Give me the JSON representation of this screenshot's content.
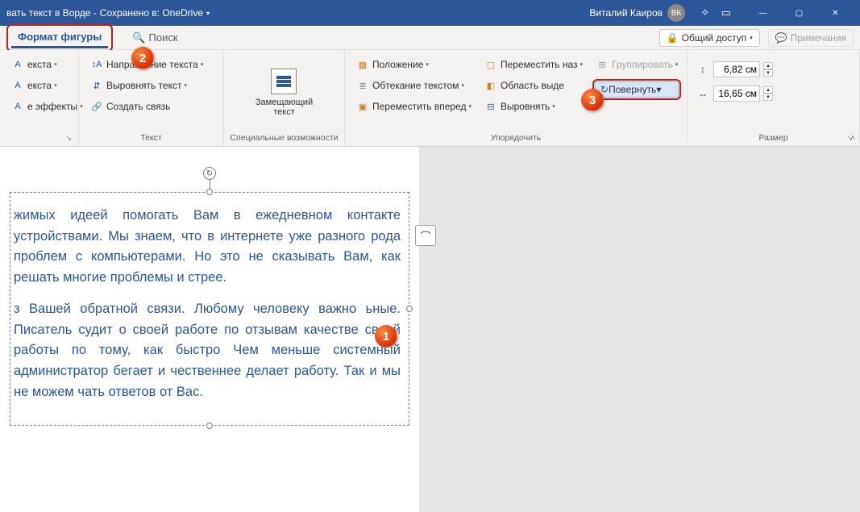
{
  "titlebar": {
    "doc_title": "вать текст в Ворде  -",
    "saved_in": "Сохранено в: OneDrive",
    "user_name": "Виталий Каиров",
    "user_initials": "ВК"
  },
  "tabs": {
    "format_shape": "Формат фигуры",
    "search": "Поиск",
    "share": "Общий доступ",
    "comments": "Примечания"
  },
  "ribbon": {
    "g1": {
      "label": "",
      "text_effects": "е эффекты",
      "text_suffix": "екста"
    },
    "text_group": {
      "label": "Текст",
      "text_direction": "Направление текста",
      "align_text": "Выровнять текст",
      "create_link": "Создать связь"
    },
    "access_group": {
      "label": "Специальные возможности",
      "alt_text": "Замещающий\nтекст"
    },
    "arrange_group": {
      "label": "Упорядочить",
      "position": "Положение",
      "wrap_text": "Обтекание текстом",
      "bring_forward": "Переместить вперед",
      "send_back": "Переместить наз",
      "selection_pane": "Область выде",
      "align": "Выровнять",
      "group": "Группировать",
      "rotate": "Повернуть"
    },
    "size_group": {
      "label": "Размер",
      "height": "6,82 см",
      "width": "16,65 см"
    }
  },
  "document": {
    "para1": "жимых идеей помогать Вам в ежедневном контакте  устройствами. Мы знаем, что в интернете уже разного рода проблем с компьютерами. Но это не сказывать Вам, как решать многие проблемы и стрее.",
    "para2": "з Вашей обратной связи. Любому человеку важно ьные. Писатель судит о своей работе по отзывам качестве своей работы по тому, как быстро  Чем меньше системный администратор бегает и чественнее делает работу. Так и мы не можем чать ответов от Вас."
  },
  "badges": {
    "b1": "1",
    "b2": "2",
    "b3": "3"
  }
}
